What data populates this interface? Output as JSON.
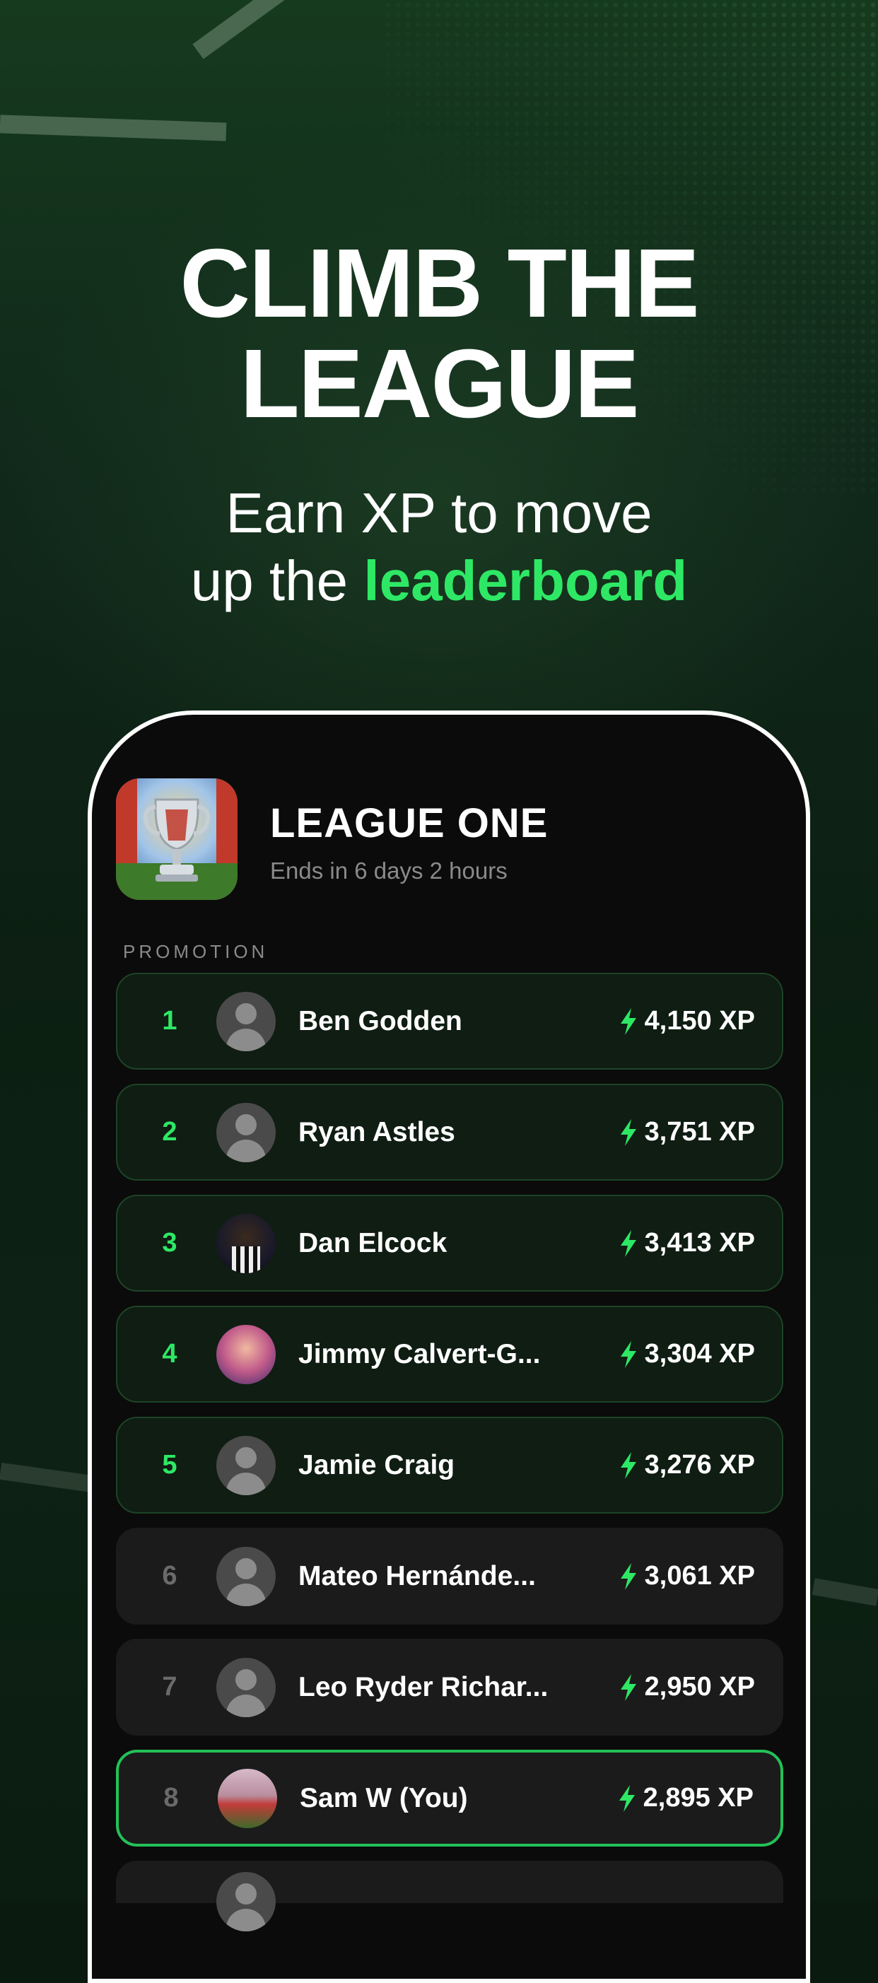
{
  "hero": {
    "title_line1": "CLIMB THE",
    "title_line2": "LEAGUE",
    "subtitle_part1": "Earn XP to move",
    "subtitle_part2": "up the ",
    "subtitle_accent": "leaderboard"
  },
  "league": {
    "title": "LEAGUE ONE",
    "ends_text": "Ends in 6 days 2 hours",
    "badge_icon": "trophy-icon"
  },
  "section_label": "PROMOTION",
  "leaderboard": [
    {
      "rank": "1",
      "name": "Ben Godden",
      "xp": "4,150 XP",
      "zone": "promotion",
      "avatar": "default-avatar-icon"
    },
    {
      "rank": "2",
      "name": "Ryan Astles",
      "xp": "3,751 XP",
      "zone": "promotion",
      "avatar": "default-avatar-icon"
    },
    {
      "rank": "3",
      "name": "Dan Elcock",
      "xp": "3,413 XP",
      "zone": "promotion",
      "avatar": "photo"
    },
    {
      "rank": "4",
      "name": "Jimmy Calvert-G...",
      "xp": "3,304 XP",
      "zone": "promotion",
      "avatar": "photo"
    },
    {
      "rank": "5",
      "name": "Jamie Craig",
      "xp": "3,276 XP",
      "zone": "promotion",
      "avatar": "default-avatar-icon"
    },
    {
      "rank": "6",
      "name": "Mateo Hernánde...",
      "xp": "3,061 XP",
      "zone": "none",
      "avatar": "default-avatar-icon"
    },
    {
      "rank": "7",
      "name": "Leo Ryder Richar...",
      "xp": "2,950 XP",
      "zone": "none",
      "avatar": "default-avatar-icon"
    },
    {
      "rank": "8",
      "name": "Sam W (You)",
      "xp": "2,895 XP",
      "zone": "current-user",
      "avatar": "photo"
    }
  ],
  "colors": {
    "accent": "#2ee865",
    "promotion_row_bg": "#0f1d13",
    "row_bg": "#1b1b1b",
    "you_border": "#23c157"
  }
}
